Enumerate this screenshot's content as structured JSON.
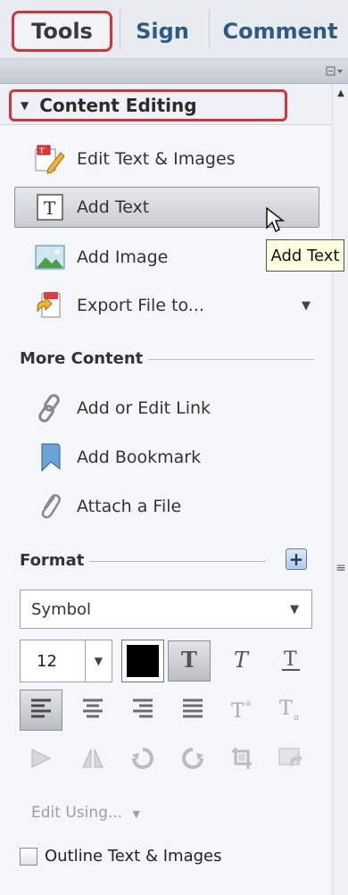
{
  "tabs": [
    {
      "label": "Tools",
      "active": true
    },
    {
      "label": "Sign",
      "active": false
    },
    {
      "label": "Comment",
      "active": false
    }
  ],
  "panel": {
    "section_title": "Content Editing",
    "items": [
      {
        "label": "Edit Text & Images",
        "icon": "edit-text-images-icon"
      },
      {
        "label": "Add Text",
        "icon": "add-text-icon",
        "selected": true
      },
      {
        "label": "Add Image",
        "icon": "add-image-icon"
      },
      {
        "label": "Export File to...",
        "icon": "export-file-icon",
        "has_dropdown": true
      }
    ],
    "tooltip": "Add Text"
  },
  "more_content": {
    "title": "More Content",
    "items": [
      {
        "label": "Add or Edit Link",
        "icon": "link-icon"
      },
      {
        "label": "Add Bookmark",
        "icon": "bookmark-icon"
      },
      {
        "label": "Attach a File",
        "icon": "paperclip-icon"
      }
    ]
  },
  "format": {
    "title": "Format",
    "font_value": "Symbol",
    "size_value": "12",
    "text_color": "#000000",
    "edit_using_label": "Edit Using...",
    "outline_label": "Outline Text & Images"
  },
  "colors": {
    "highlight_red": "#d8323a",
    "tab_blue": "#2f5a86"
  }
}
